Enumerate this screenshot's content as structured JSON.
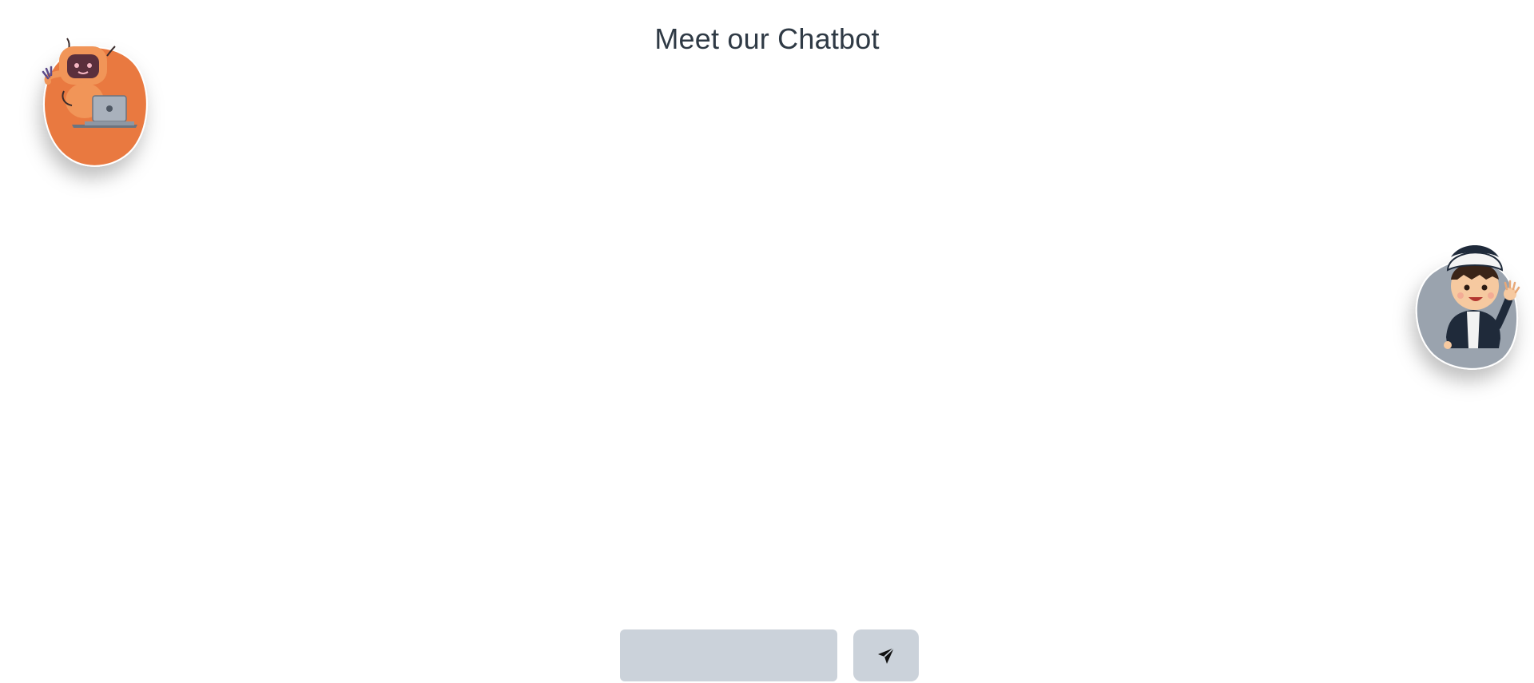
{
  "header": {
    "title": "Meet our Chatbot"
  },
  "avatars": {
    "bot": {
      "icon": "robot-with-laptop-icon",
      "color": "#e97941"
    },
    "user": {
      "icon": "boy-waving-icon",
      "color": "#9aa3ae"
    }
  },
  "composer": {
    "input_value": "",
    "input_placeholder": "",
    "send_icon": "paper-plane-icon",
    "field_color": "#cbd2da"
  }
}
